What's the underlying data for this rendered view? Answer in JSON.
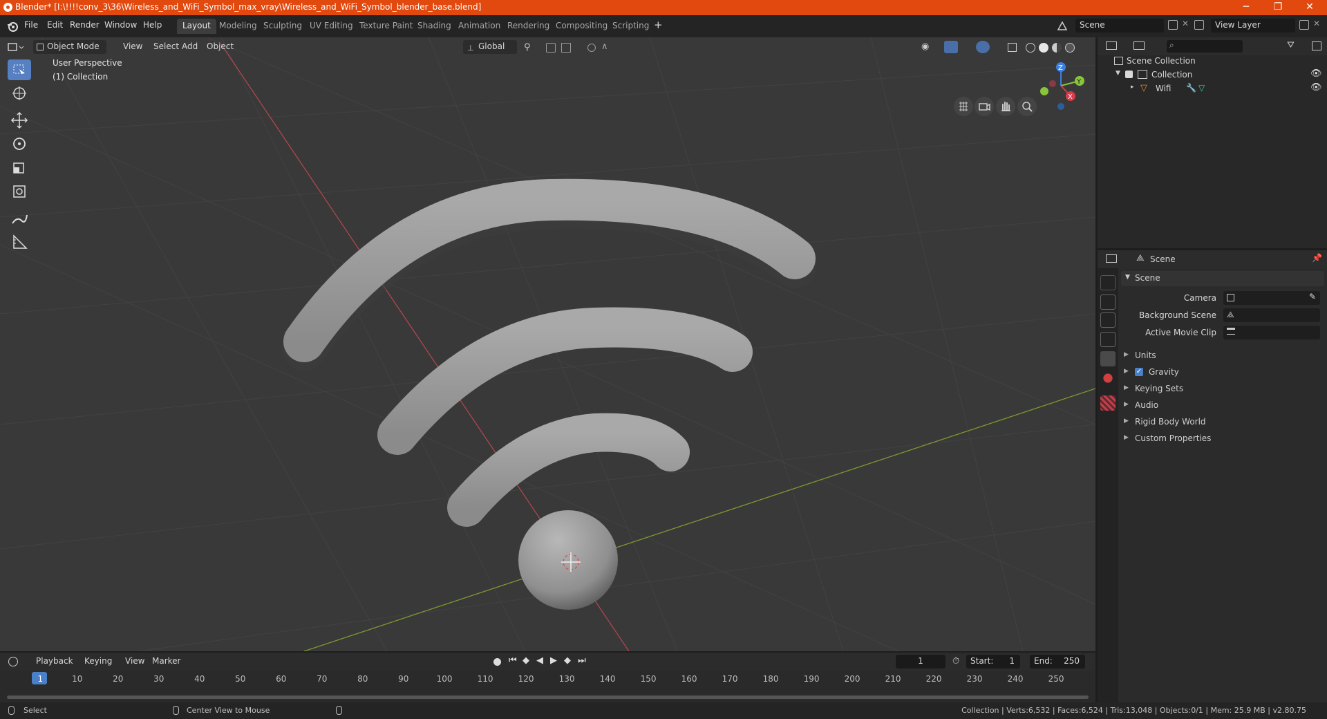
{
  "window": {
    "title": "Blender* [I:\\!!!!conv_3\\36\\Wireless_and_WiFi_Symbol_max_vray\\Wireless_and_WiFi_Symbol_blender_base.blend]",
    "minimize": "─",
    "maximize": "❐",
    "close": "✕"
  },
  "menu": {
    "file": "File",
    "edit": "Edit",
    "render": "Render",
    "window": "Window",
    "help": "Help"
  },
  "workspaces": [
    {
      "label": "Layout",
      "active": true
    },
    {
      "label": "Modeling"
    },
    {
      "label": "Sculpting"
    },
    {
      "label": "UV Editing"
    },
    {
      "label": "Texture Paint"
    },
    {
      "label": "Shading"
    },
    {
      "label": "Animation"
    },
    {
      "label": "Rendering"
    },
    {
      "label": "Compositing"
    },
    {
      "label": "Scripting"
    }
  ],
  "add_workspace": "+",
  "scene_field": "Scene",
  "view_layer_field": "View Layer",
  "viewport_header": {
    "mode": "Object Mode",
    "view": "View",
    "select": "Select",
    "add": "Add",
    "object": "Object",
    "transform_orientation": "Global"
  },
  "viewport_overlay": {
    "perspective": "User Perspective",
    "collection": "(1) Collection"
  },
  "gizmo": {
    "x": "X",
    "y": "Y",
    "z": "Z"
  },
  "outliner": {
    "root": "Scene Collection",
    "collection": "Collection",
    "object": "Wifi"
  },
  "properties": {
    "header": "Scene",
    "panel_title": "Scene",
    "camera_label": "Camera",
    "bg_scene_label": "Background Scene",
    "movie_clip_label": "Active Movie Clip",
    "panels": [
      "Units",
      "Gravity",
      "Keying Sets",
      "Audio",
      "Rigid Body World",
      "Custom Properties"
    ]
  },
  "timeline": {
    "playback": "Playback",
    "keying": "Keying",
    "view": "View",
    "marker": "Marker",
    "current_frame": "1",
    "start_label": "Start:",
    "start": "1",
    "end_label": "End:",
    "end": "250",
    "ticks": [
      "1",
      "10",
      "20",
      "30",
      "40",
      "50",
      "60",
      "70",
      "80",
      "90",
      "100",
      "110",
      "120",
      "130",
      "140",
      "150",
      "160",
      "170",
      "180",
      "190",
      "200",
      "210",
      "220",
      "230",
      "240",
      "250"
    ]
  },
  "status": {
    "select": "Select",
    "center_view": "Center View to Mouse",
    "stats": "Collection | Verts:6,532 | Faces:6,524 | Tris:13,048 | Objects:0/1 | Mem: 25.9 MB | v2.80.75"
  },
  "colors": {
    "titlebar": "#e1490f",
    "active_tool": "#5680c2",
    "axis_x": "#d83b4a",
    "axis_y": "#8ac43a",
    "axis_z": "#3d7fe0"
  }
}
